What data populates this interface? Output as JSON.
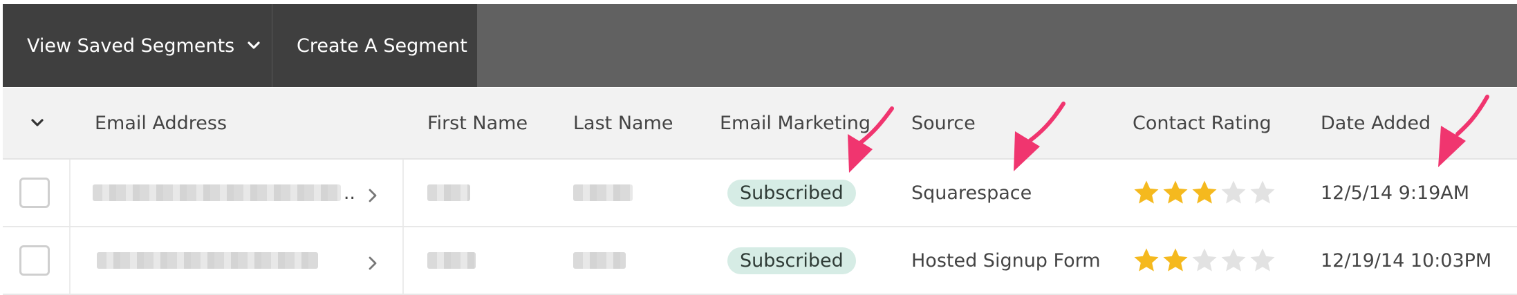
{
  "toolbar": {
    "view_saved_label": "View Saved Segments",
    "create_segment_label": "Create A Segment"
  },
  "table": {
    "columns": [
      "Email Address",
      "First Name",
      "Last Name",
      "Email Marketing",
      "Source",
      "Contact Rating",
      "Date Added"
    ],
    "rows": [
      {
        "email_marketing": "Subscribed",
        "source": "Squarespace",
        "rating": 3,
        "date_added": "12/5/14 9:19AM",
        "email_suffix": ".."
      },
      {
        "email_marketing": "Subscribed",
        "source": "Hosted Signup Form",
        "rating": 2,
        "date_added": "12/19/14 10:03PM",
        "email_suffix": ""
      }
    ]
  },
  "colors": {
    "toolbar_dark": "#3f3f3f",
    "toolbar_bg": "#616161",
    "badge_bg": "#d6ece5",
    "star_filled": "#f5b91e",
    "star_empty": "#e2e2e2",
    "annotation_arrow": "#f0356f"
  },
  "icons": {
    "view_saved_chevron": "chevron-down-icon",
    "header_select": "chevron-down-icon",
    "row_expand": "chevron-right-icon",
    "rating": "star-icon"
  }
}
